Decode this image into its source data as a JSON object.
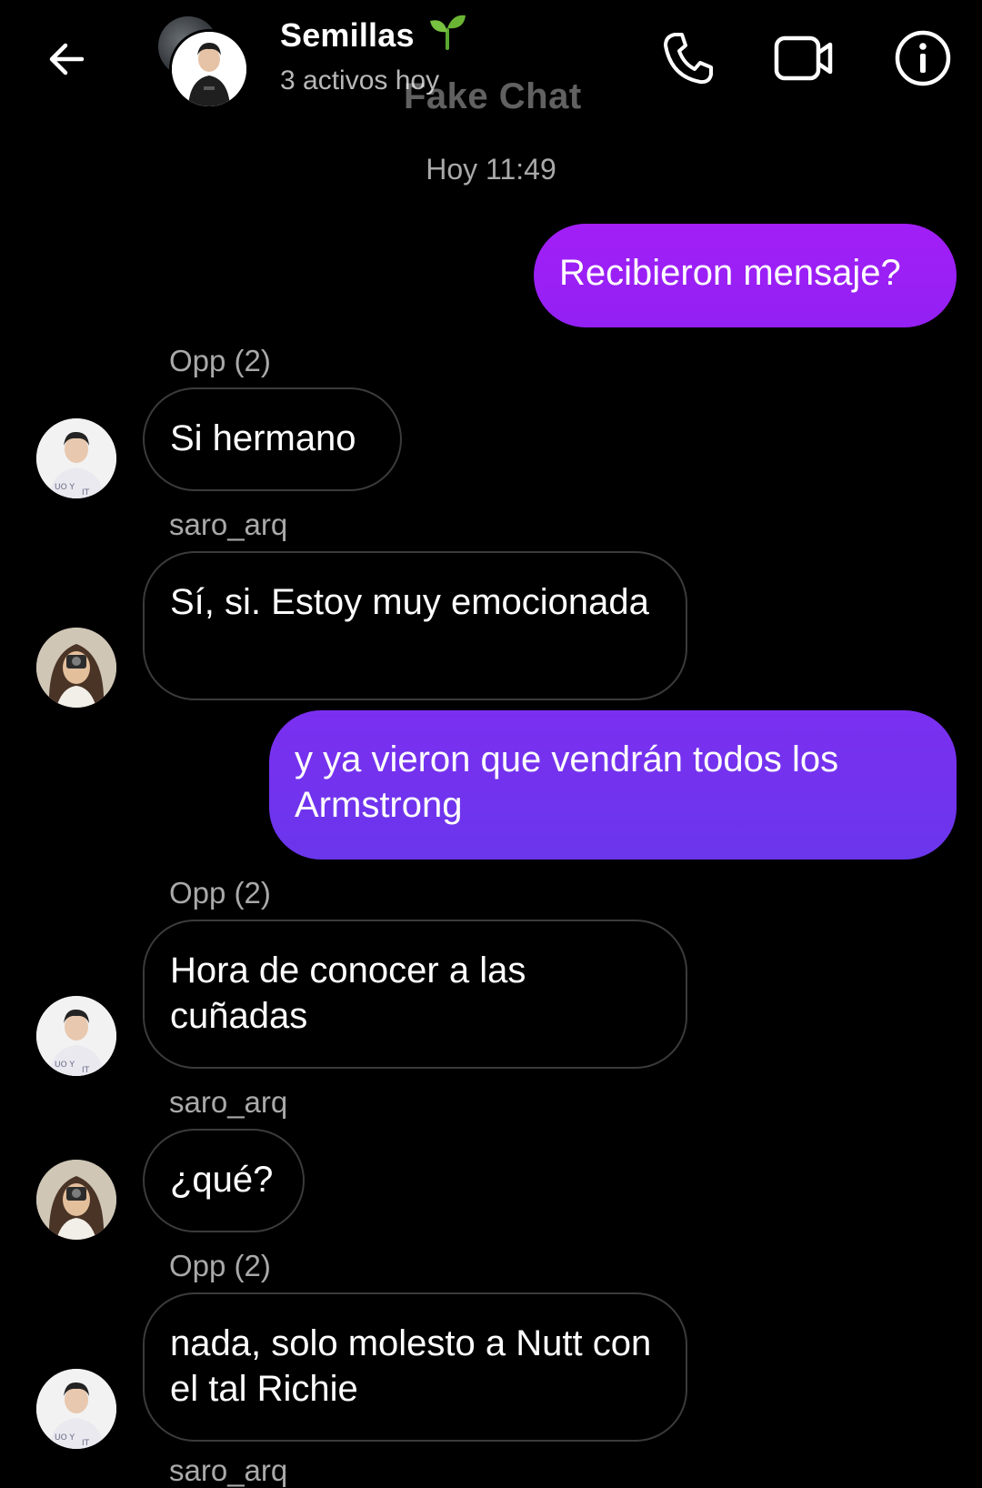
{
  "header": {
    "title": "Semillas",
    "status": "3 activos hoy",
    "watermark": "Fake Chat",
    "icons": {
      "back": "back-arrow-icon",
      "sprout": "sprout-emoji-icon",
      "call": "phone-icon",
      "video": "video-camera-icon",
      "info": "info-icon"
    }
  },
  "thread": {
    "timestamp": "Hoy 11:49",
    "messages": [
      {
        "direction": "out",
        "text": "Recibieron mensaje?"
      },
      {
        "direction": "in",
        "sender": "Opp (2)",
        "text": "Si hermano"
      },
      {
        "direction": "in",
        "sender": "saro_arq",
        "text": "Sí, si. Estoy muy emocionada"
      },
      {
        "direction": "out",
        "text": "y ya vieron que vendrán todos los Armstrong"
      },
      {
        "direction": "in",
        "sender": "Opp (2)",
        "text": "Hora de conocer a las cuñadas"
      },
      {
        "direction": "in",
        "sender": "saro_arq",
        "text": "¿qué?"
      },
      {
        "direction": "in",
        "sender": "Opp (2)",
        "text": "nada, solo molesto a Nutt con el tal Richie"
      },
      {
        "direction": "in",
        "sender": "saro_arq"
      }
    ]
  },
  "colors": {
    "background": "#000000",
    "outgoing_bubble_top": "#9a1df5",
    "outgoing_bubble_bottom": "#6a36ec",
    "incoming_bubble_border": "#3b3b3b",
    "secondary_text": "#a9a9a9"
  }
}
